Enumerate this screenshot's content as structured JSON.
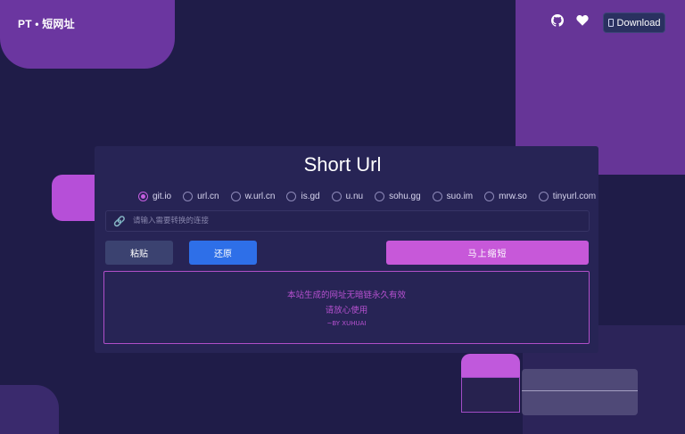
{
  "header": {
    "brand": "PT • 短网址",
    "icons": [
      "github-icon",
      "heart-icon"
    ],
    "download_label": "Download"
  },
  "card": {
    "title": "Short Url",
    "options": [
      {
        "label": "git.io",
        "checked": true
      },
      {
        "label": "url.cn",
        "checked": false
      },
      {
        "label": "w.url.cn",
        "checked": false
      },
      {
        "label": "is.gd",
        "checked": false
      },
      {
        "label": "u.nu",
        "checked": false
      },
      {
        "label": "sohu.gg",
        "checked": false
      },
      {
        "label": "suo.im",
        "checked": false
      },
      {
        "label": "mrw.so",
        "checked": false
      },
      {
        "label": "tinyurl.com",
        "checked": false
      }
    ],
    "input": {
      "placeholder": "请输入需要转换的连接",
      "value": ""
    },
    "buttons": {
      "paste": "粘贴",
      "restore": "还原",
      "shorten": "马上缩短"
    },
    "result": {
      "line1": "本站生成的网址无暗链永久有效",
      "line2": "请放心使用",
      "by": "~BY XUHUAI"
    }
  },
  "colors": {
    "background": "#1f1c48",
    "card": "#272455",
    "accent": "#c758d9",
    "restore_button": "#2e6fe8",
    "paste_button": "#3b4270"
  }
}
